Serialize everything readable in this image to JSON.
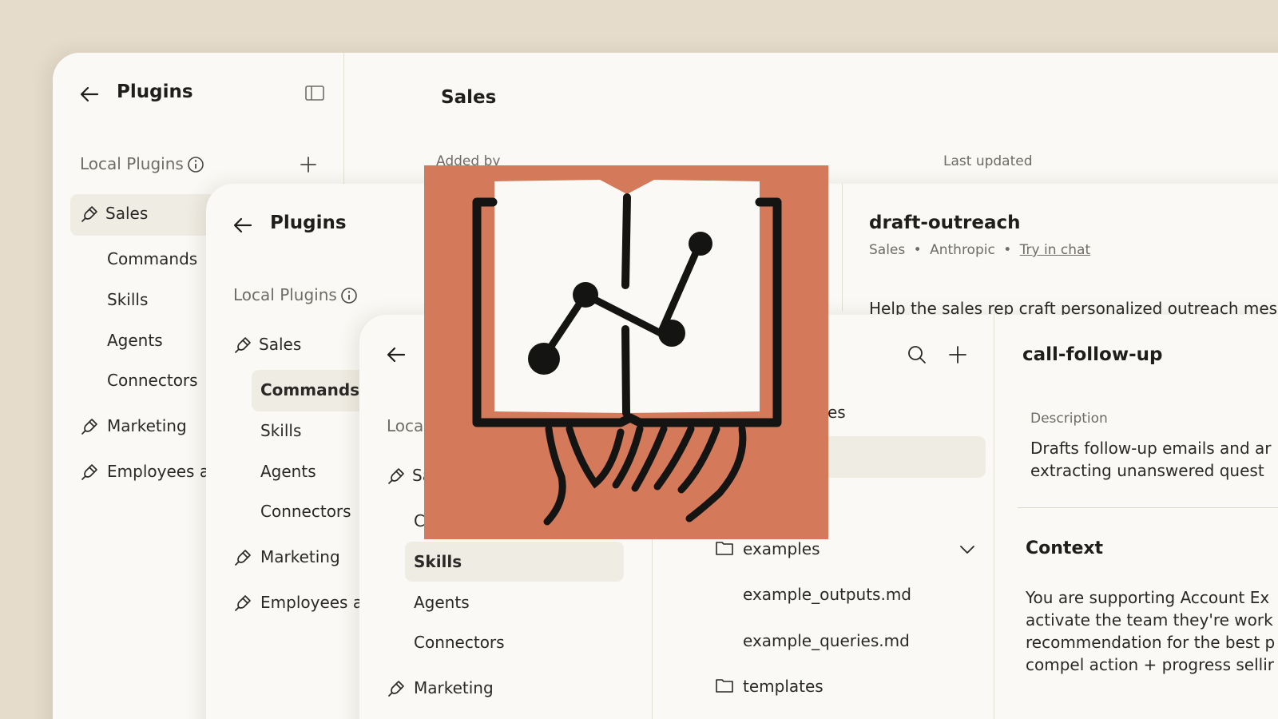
{
  "colors": {
    "background": "#e5dccb",
    "panel": "#faf9f5",
    "selected": "#efece3",
    "illustration": "#d4795a",
    "ink": "#141413"
  },
  "panel1": {
    "title": "Plugins",
    "local_plugins": "Local Plugins",
    "plugins": [
      {
        "name": "Sales",
        "icon": "plug-icon"
      },
      {
        "name": "Marketing",
        "icon": "plug-icon"
      },
      {
        "name": "Employees at"
      }
    ],
    "sub_items": [
      "Commands",
      "Skills",
      "Agents",
      "Connectors"
    ],
    "detail": {
      "title": "Sales",
      "added_by": "Added by",
      "last_updated": "Last updated"
    }
  },
  "panel2": {
    "title": "Plugins",
    "local_plugins": "Local Plugins",
    "plugins": [
      "Sales",
      "Marketing",
      "Employees at"
    ],
    "sub_items": [
      "Commands",
      "Skills",
      "Agents",
      "Connectors"
    ],
    "selected": "Commands",
    "command": {
      "name": "draft-outreach",
      "plugin": "Sales",
      "author": "Anthropic",
      "try_link": "Try in chat",
      "description": "Help the sales rep craft personalized outreach mes"
    }
  },
  "panel3": {
    "local_plugins_partial": "Loca",
    "sales_partial": "Sa",
    "commands_partial": "C",
    "sub_items": [
      "Skills",
      "Agents",
      "Connectors"
    ],
    "selected": "Skills",
    "marketing": "Marketing",
    "files_partial": "es",
    "files": {
      "folder_examples": "examples",
      "file_1": "example_outputs.md",
      "file_2": "example_queries.md",
      "folder_templates": "templates"
    },
    "skill": {
      "name": "call-follow-up",
      "description_label": "Description",
      "description_line1": "Drafts follow-up emails and ar",
      "description_line2": "extracting unanswered quest",
      "context_heading": "Context",
      "context_lines": [
        "You are supporting Account Ex",
        "activate the team they're work",
        "recommendation for the best p",
        "compel action + progress sellir"
      ]
    }
  }
}
